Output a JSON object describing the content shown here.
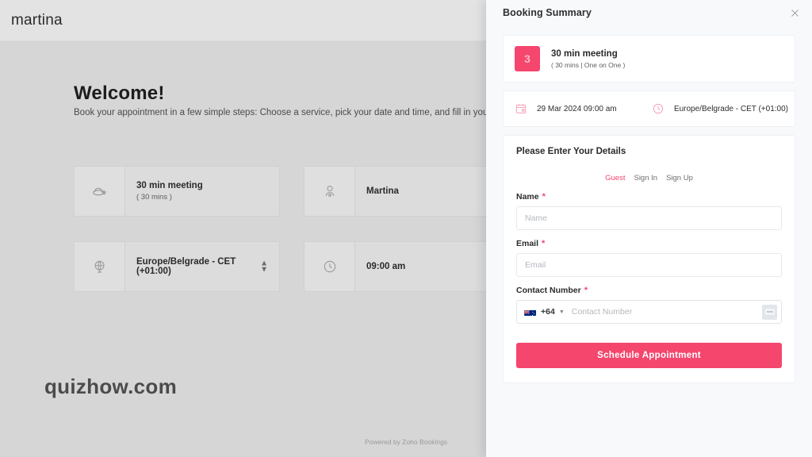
{
  "background": {
    "brand": "martina",
    "welcome_title": "Welcome!",
    "welcome_desc": "Book your appointment in a few simple steps: Choose a service, pick your date and time, and fill in your details. S",
    "watermark": "quizhow.com",
    "powered_by": "Powered by Zoho Bookings",
    "cards": [
      {
        "icon": "service-icon",
        "title": "30 min meeting",
        "sub": "( 30 mins )",
        "stepper": false
      },
      {
        "icon": "staff-icon",
        "title": "Martina",
        "sub": "",
        "stepper": false
      },
      {
        "icon": "globe-icon",
        "title": "Europe/Belgrade - CET (+01:00)",
        "sub": "",
        "stepper": true
      },
      {
        "icon": "clock-icon",
        "title": "09:00 am",
        "sub": "",
        "stepper": false
      }
    ]
  },
  "summary": {
    "title": "Booking Summary",
    "close_icon": "close-icon",
    "service": {
      "badge": "3",
      "name": "30 min meeting",
      "meta": "( 30 mins | One on One )"
    },
    "when": {
      "date_icon": "calendar-icon",
      "date": "29 Mar 2024 09:00 am",
      "timezone_icon": "clock-icon",
      "timezone": "Europe/Belgrade - CET (+01:00)"
    },
    "details": {
      "heading": "Please Enter Your Details",
      "tabs": [
        {
          "label": "Guest",
          "active": true
        },
        {
          "label": "Sign In",
          "active": false
        },
        {
          "label": "Sign Up",
          "active": false
        }
      ],
      "name_label": "Name",
      "name_value": "",
      "name_placeholder": "Name",
      "email_label": "Email",
      "email_value": "",
      "email_placeholder": "Email",
      "phone_label": "Contact Number",
      "phone_flag": "nz-flag-icon",
      "phone_dial_code": "+64",
      "phone_value": "",
      "phone_placeholder": "Contact Number",
      "keypad_icon": "keypad-icon",
      "required_marker": "*",
      "submit_label": "Schedule Appointment"
    }
  },
  "colors": {
    "accent": "#f5466e",
    "panel_bg": "#f7f9fb",
    "page_bg": "#d6d6d6"
  }
}
